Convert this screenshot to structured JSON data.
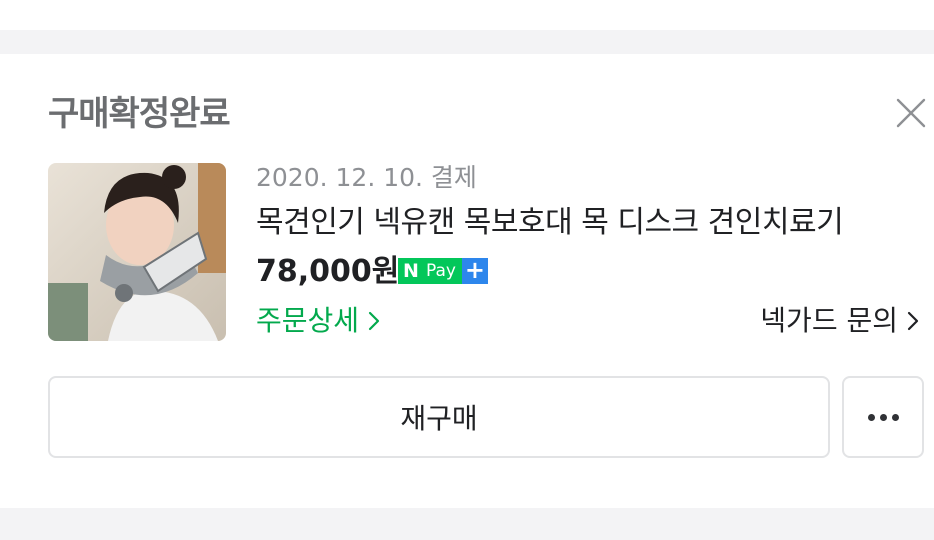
{
  "order": {
    "status": "구매확정완료",
    "date": "2020. 12. 10. 결제",
    "product_name": "목견인기 넥유캔 목보호대 목 디스크 견인치료기",
    "price": "78,000원",
    "payment_badge": {
      "n": "N",
      "pay": "Pay",
      "plus": "+"
    },
    "order_detail_link": "주문상세",
    "seller_inquiry_link": "넥가드 문의",
    "rebuy_button": "재구매"
  },
  "icons": {
    "close": "close-icon",
    "more": "more-dots-icon",
    "chevron": "chevron-right-icon"
  },
  "colors": {
    "accent_green": "#03a94d",
    "npay_green": "#03c75a",
    "npay_blue": "#2d86ec",
    "status_gray": "#6b6d70"
  }
}
